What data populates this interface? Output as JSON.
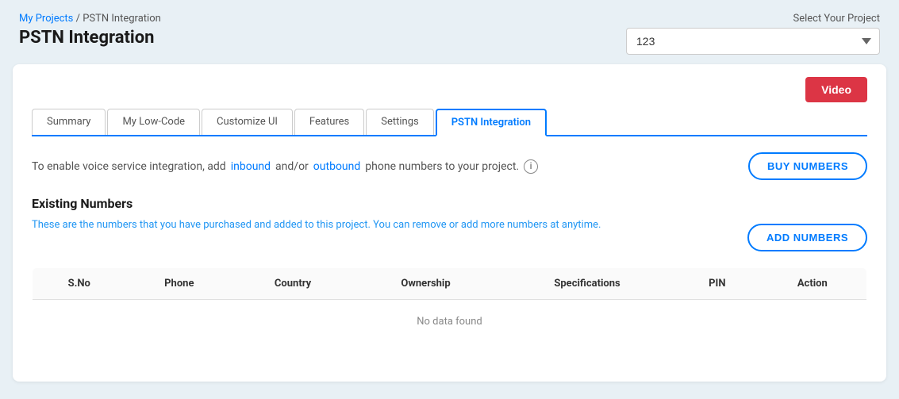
{
  "header": {
    "breadcrumb_link": "My Projects",
    "breadcrumb_separator": " / ",
    "breadcrumb_current": "PSTN Integration",
    "page_title": "PSTN Integration",
    "project_selector_label": "Select Your Project",
    "project_selected": "123"
  },
  "video_button_label": "Video",
  "tabs": [
    {
      "id": "summary",
      "label": "Summary",
      "active": false
    },
    {
      "id": "my-low-code",
      "label": "My Low-Code",
      "active": false
    },
    {
      "id": "customize-ui",
      "label": "Customize UI",
      "active": false
    },
    {
      "id": "features",
      "label": "Features",
      "active": false
    },
    {
      "id": "settings",
      "label": "Settings",
      "active": false
    },
    {
      "id": "pstn-integration",
      "label": "PSTN Integration",
      "active": true
    }
  ],
  "voice_info": {
    "text_prefix": "To enable voice service integration, add",
    "link1": "inbound",
    "text_mid1": "and/or",
    "link2": "outbound",
    "text_mid2": "phone numbers to your project.",
    "buy_numbers_label": "BUY NUMBERS"
  },
  "existing_numbers": {
    "section_title": "Existing Numbers",
    "description": "These are the numbers that you have purchased and added to this project. You can remove or add more numbers at anytime.",
    "add_numbers_label": "ADD NUMBERS"
  },
  "table": {
    "columns": [
      "S.No",
      "Phone",
      "Country",
      "Ownership",
      "Specifications",
      "PIN",
      "Action"
    ],
    "no_data_text": "No data found"
  }
}
